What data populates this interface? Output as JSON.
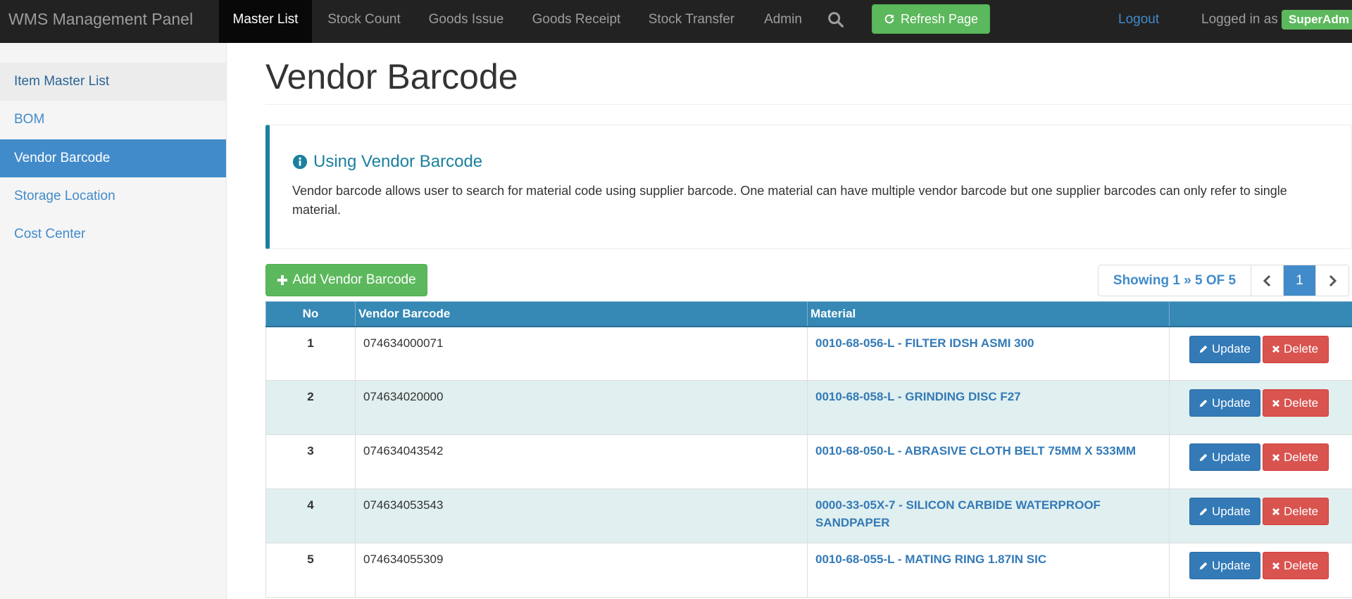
{
  "navbar": {
    "brand": "WMS Management Panel",
    "items": [
      {
        "label": "Master List"
      },
      {
        "label": "Stock Count"
      },
      {
        "label": "Goods Issue"
      },
      {
        "label": "Goods Receipt"
      },
      {
        "label": "Stock Transfer"
      },
      {
        "label": "Admin"
      }
    ],
    "search_icon": "search-icon",
    "refresh_label": "Refresh Page",
    "refresh_icon": "refresh-icon",
    "logout_label": "Logout",
    "logged_in_label": "Logged in as",
    "role": "SuperAdm"
  },
  "sidebar": {
    "items": [
      {
        "label": "Item Master List"
      },
      {
        "label": "BOM"
      },
      {
        "label": "Vendor Barcode"
      },
      {
        "label": "Storage Location"
      },
      {
        "label": "Cost Center"
      }
    ]
  },
  "main": {
    "title": "Vendor Barcode",
    "callout": {
      "icon": "info-circle-icon",
      "title": "Using Vendor Barcode",
      "text": "Vendor barcode allows user to search for material code using supplier barcode. One material can have multiple vendor barcode but one supplier barcodes can only refer to single material."
    },
    "add_button": "Add Vendor Barcode",
    "pager": {
      "info": "Showing 1 » 5 OF 5",
      "current_page": "1"
    },
    "table": {
      "columns": [
        "No",
        "Vendor Barcode",
        "Material",
        ""
      ],
      "rows": [
        {
          "no": "1",
          "barcode": "074634000071",
          "material": "0010-68-056-L - FILTER IDSH ASMI 300"
        },
        {
          "no": "2",
          "barcode": "074634020000",
          "material": "0010-68-058-L - GRINDING DISC F27"
        },
        {
          "no": "3",
          "barcode": "074634043542",
          "material": "0010-68-050-L - ABRASIVE CLOTH BELT 75MM X 533MM"
        },
        {
          "no": "4",
          "barcode": "074634053543",
          "material": "0000-33-05X-7 - SILICON CARBIDE WATERPROOF SANDPAPER"
        },
        {
          "no": "5",
          "barcode": "074634055309",
          "material": "0010-68-055-L - MATING RING 1.87IN SIC"
        }
      ],
      "update_label": "Update",
      "delete_label": "Delete"
    }
  },
  "colors": {
    "navbar_bg": "#222222",
    "sidebar_active": "#428bca",
    "table_header": "#3688b5",
    "success": "#5cb85c",
    "danger": "#d9534f",
    "primary": "#337ab7"
  }
}
